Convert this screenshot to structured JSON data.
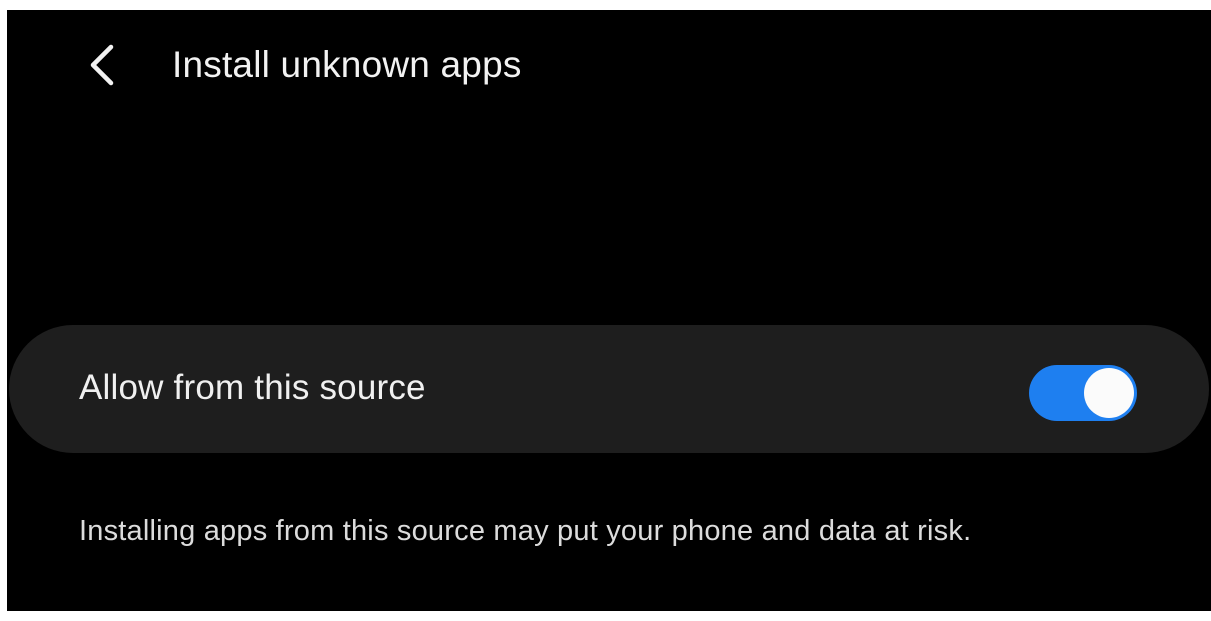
{
  "header": {
    "back_icon": "chevron-left-icon",
    "title": "Install unknown apps"
  },
  "setting": {
    "label": "Allow from this source",
    "enabled": true,
    "accent_color": "#1e7ff0"
  },
  "warning_text": "Installing apps from this source may put your phone and data at risk."
}
